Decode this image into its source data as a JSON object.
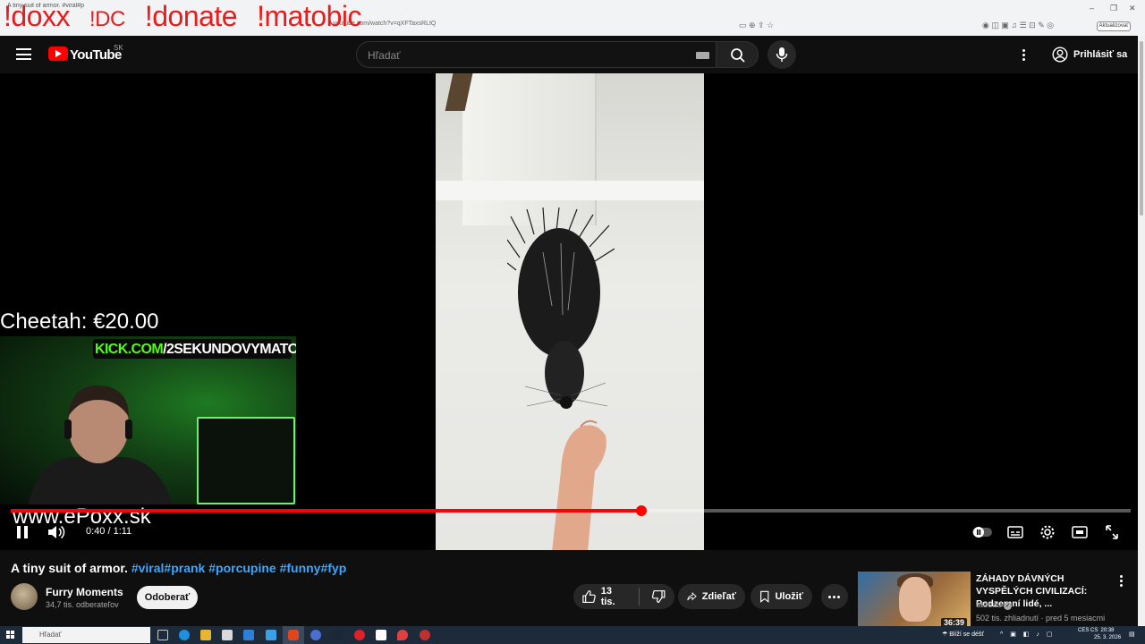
{
  "browser": {
    "tab_title": "A tiny suit of armor. #viral#p",
    "url": "youtube.com/watch?v=qXFTaxsRLtQ",
    "update_label": "Aktualizovať",
    "win_minimize": "–",
    "win_restore": "❐",
    "win_close": "✕"
  },
  "stream_overlay": {
    "cmd_doxx": "!doxx",
    "cmd_dc": "!DC",
    "cmd_donate": "!donate",
    "cmd_matobic": "!matobic",
    "donation": "Cheetah: €20.00",
    "kick_domain": "KICK.COM",
    "kick_channel": "/2SEKUNDOVYMATO",
    "site": "www.ePoxx.sk"
  },
  "header": {
    "logo_text": "YouTube",
    "country_code": "SK",
    "search_placeholder": "Hľadať",
    "signin_label": "Prihlásiť sa"
  },
  "player": {
    "time_label": "0:40 / 1:11",
    "progress": 0.5633,
    "accent_color": "#ff0000"
  },
  "video": {
    "title_text": "A tiny suit of armor.",
    "title_tags": "#viral#prank #porcupine #funny#fyp",
    "channel_name": "Furry Moments",
    "subscribers": "34,7 tis. odberateľov",
    "subscribe_label": "Odoberať",
    "likes": "13 tis.",
    "share_label": "Zdieľať",
    "save_label": "Uložiť"
  },
  "recommended": {
    "title": "ZÁHADY DÁVNÝCH VYSPĚLÝCH CIVILIZACÍ: Podzemní lidé, ...",
    "channel": "tadeas",
    "meta": "502 tis. zhliadnutí · pred 5 mesiacmi",
    "duration": "36:39"
  },
  "taskbar": {
    "search_placeholder": "Hľadať",
    "weather": "Blíží se déšť",
    "lang": "CES CS",
    "time": "20:38",
    "date": "25. 3. 2026"
  }
}
